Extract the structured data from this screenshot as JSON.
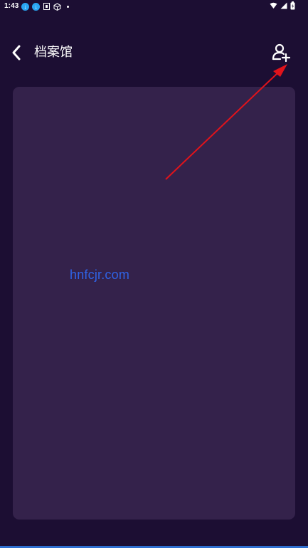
{
  "status_bar": {
    "time": "1:43",
    "left_icons": [
      "download-icon",
      "download-icon",
      "sim-icon",
      "cube-icon",
      "dot-icon"
    ],
    "right_icons": [
      "wifi-icon",
      "signal-icon",
      "battery-icon"
    ]
  },
  "header": {
    "back_icon": "chevron-left-icon",
    "title": "档案馆",
    "action_icon": "add-user-icon"
  },
  "content": {
    "watermark": "hnfcjr.com"
  },
  "colors": {
    "background": "#1c0e33",
    "card": "#34224b",
    "accent_arrow": "#e1131b",
    "watermark": "#2f63e6"
  }
}
